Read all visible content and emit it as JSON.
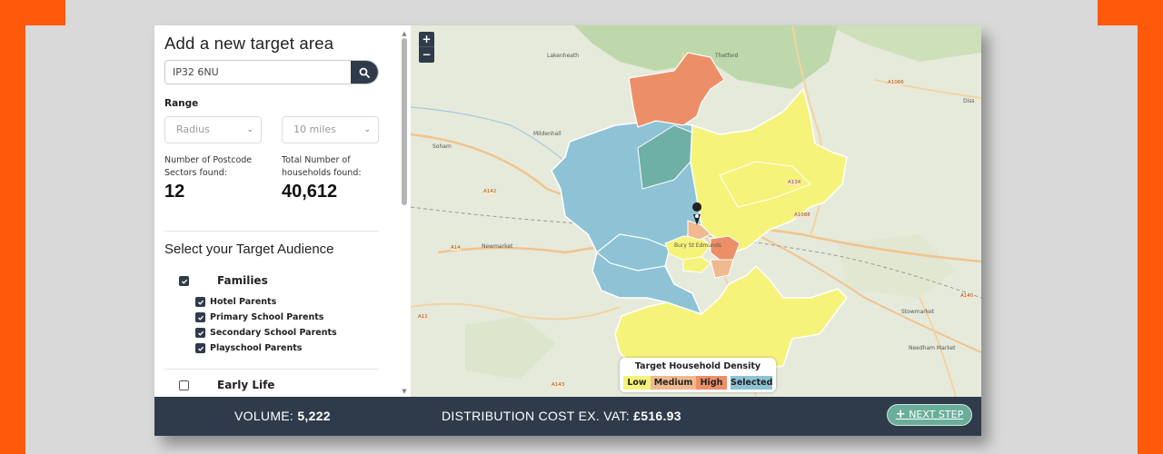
{
  "sidebar": {
    "title": "Add a new target area",
    "search": {
      "value": "IP32 6NU",
      "icon": "search-icon"
    },
    "range_label": "Range",
    "range_type": {
      "selected": "Radius"
    },
    "range_distance": {
      "selected": "10 miles"
    },
    "stats": {
      "sectors_label": "Number of Postcode Sectors found:",
      "sectors_value": "12",
      "households_label": "Total Number of households found:",
      "households_value": "40,612"
    },
    "audience_title": "Select your Target Audience",
    "groups": [
      {
        "label": "Families",
        "checked": true,
        "items": [
          {
            "label": "Hotel Parents",
            "checked": true
          },
          {
            "label": "Primary School Parents",
            "checked": true
          },
          {
            "label": "Secondary School Parents",
            "checked": true
          },
          {
            "label": "Playschool Parents",
            "checked": true
          }
        ]
      },
      {
        "label": "Early Life",
        "checked": false
      }
    ]
  },
  "map": {
    "zoom_in": "+",
    "zoom_out": "−",
    "place_labels": {
      "lakenheath": "Lakenheath",
      "mildenhall": "Mildenhall",
      "soham": "Soham",
      "newmarket": "Newmarket",
      "bury": "Bury St Edmunds",
      "stowmarket": "Stowmarket",
      "needham": "Needham Market",
      "diss": "Diss",
      "thetford": "Thetford"
    },
    "road_labels": {
      "a1066": "A1066",
      "a142": "A142",
      "a14": "A14",
      "a11": "A11",
      "a1088": "A1088",
      "a143": "A143",
      "a140": "A140",
      "a134": "A134"
    },
    "legend": {
      "title": "Target Household Density",
      "low": "Low",
      "medium": "Medium",
      "high": "High",
      "selected": "Selected"
    },
    "colors": {
      "low": "#f6f37a",
      "medium": "#f0b98f",
      "high": "#ec8f68",
      "selected": "#8ec3d6",
      "selected_dark": "#6fb0a6"
    }
  },
  "footer": {
    "volume_label": "VOLUME:",
    "volume_value": "5,222",
    "cost_label": "DISTRIBUTION COST EX. VAT:",
    "cost_value": "£516.93",
    "next_step": "NEXT STEP"
  }
}
